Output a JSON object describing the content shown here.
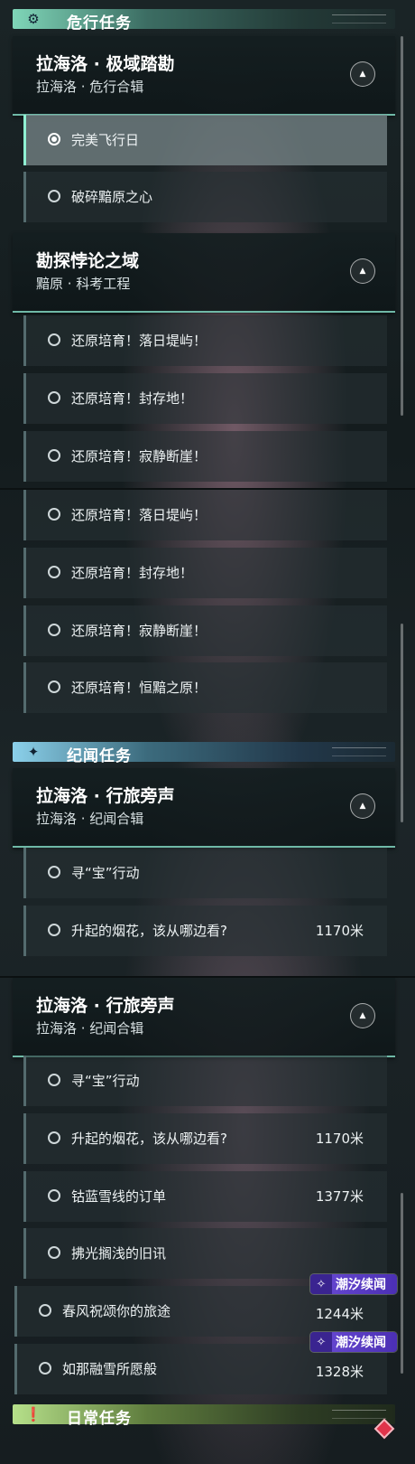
{
  "section_danger": {
    "title": "危行任务",
    "icon": "gear-badge-icon"
  },
  "section_journal": {
    "title": "纪闻任务",
    "icon": "sparkle-icon"
  },
  "section_daily": {
    "title": "日常任务",
    "icon": "exclamation-icon"
  },
  "groups": {
    "laihailuo_jiyu": {
      "title": "拉海洛 · 极域踏勘",
      "subtitle": "拉海洛 · 危行合辑"
    },
    "kantan": {
      "title": "勘探悖论之域",
      "subtitle": "黯原 · 科考工程"
    },
    "laihailuo_xinglv": {
      "title": "拉海洛 · 行旅旁声",
      "subtitle": "拉海洛 · 纪闻合辑"
    }
  },
  "quests": {
    "wanmei": "完美飞行日",
    "posui": "破碎黯原之心",
    "luori": "还原培育！落日堤屿！",
    "fengcun": "还原培育！封存地！",
    "jijing": "还原培育！寂静断崖！",
    "hengan": "还原培育！恒黯之原！",
    "xunbao": "寻“宝”行动",
    "yanhua": "升起的烟花，该从哪边看?",
    "dingdan": "钴蓝雪线的订单",
    "jiuxun": "拂光搁浅的旧讯",
    "chunfeng": "春风祝颂你的旅途",
    "rongxue": "如那融雪所愿般"
  },
  "distances": {
    "yanhua": "1170米",
    "dingdan": "1377米",
    "chunfeng": "1244米",
    "rongxue": "1328米"
  },
  "badge_label": "潮汐续闻",
  "colors": {
    "accent_teal": "#7fd6b8",
    "badge_purple": "#6b4cd6",
    "alert_red": "#e0344b"
  }
}
